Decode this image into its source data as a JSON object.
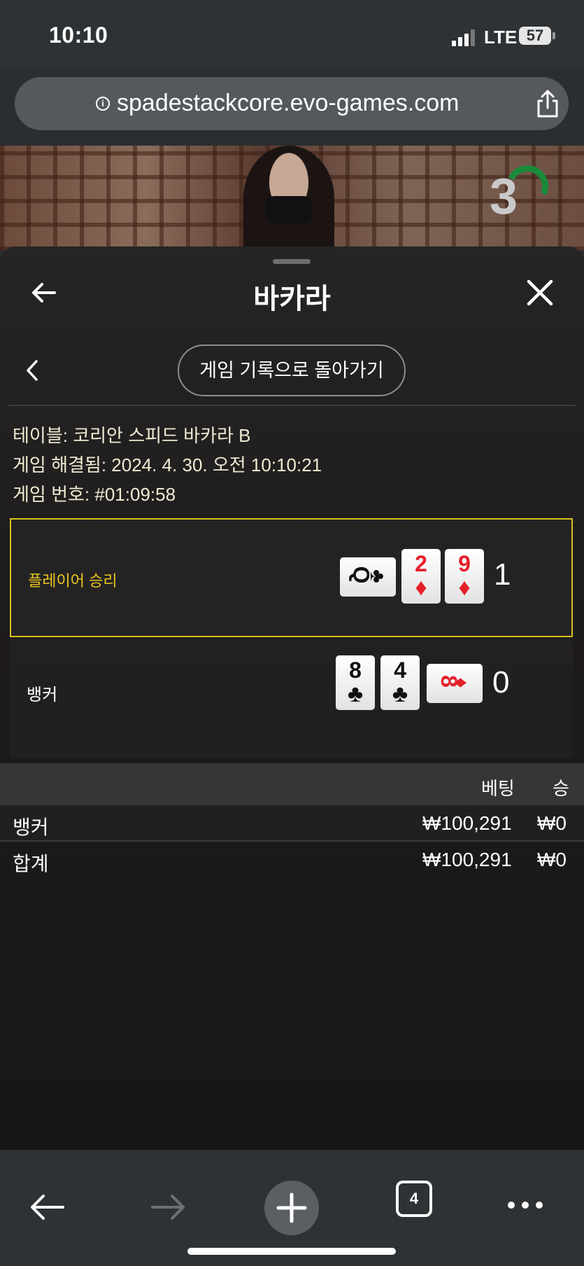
{
  "status_bar": {
    "time": "10:10",
    "network": "LTE",
    "battery": "57"
  },
  "browser": {
    "url": "spadestackcore.evo-games.com",
    "tab_count": "4"
  },
  "video": {
    "countdown": "3"
  },
  "sheet": {
    "title": "바카라",
    "history_button": "게임 기록으로 돌아가기"
  },
  "details": {
    "table_label": "테이블:",
    "table_value": "코리안 스피드 바카라 B",
    "resolved_label": "게임 해결됨:",
    "resolved_value": "2024. 4. 30. 오전 10:10:21",
    "game_no_label": "게임 번호:",
    "game_no_value": "#01:09:58"
  },
  "results": {
    "player": {
      "label": "플레이어 승리",
      "score": "1",
      "cards": [
        {
          "rank": "Q",
          "suit": "♣",
          "color": "black",
          "orientation": "sideways"
        },
        {
          "rank": "2",
          "suit": "♦",
          "color": "red",
          "orientation": "upright"
        },
        {
          "rank": "9",
          "suit": "♦",
          "color": "red",
          "orientation": "upright"
        }
      ]
    },
    "banker": {
      "label": "뱅커",
      "score": "0",
      "cards": [
        {
          "rank": "8",
          "suit": "♣",
          "color": "black",
          "orientation": "upright"
        },
        {
          "rank": "4",
          "suit": "♣",
          "color": "black",
          "orientation": "upright"
        },
        {
          "rank": "8",
          "suit": "♦",
          "color": "red",
          "orientation": "sideways"
        }
      ]
    }
  },
  "bets_table": {
    "headers": {
      "bet": "베팅",
      "win": "승"
    },
    "rows": [
      {
        "name": "뱅커",
        "bet": "₩100,291",
        "win": "₩0"
      },
      {
        "name": "합계",
        "bet": "₩100,291",
        "win": "₩0"
      }
    ]
  },
  "colors": {
    "highlight": "#d8c21e",
    "red_suit": "#e4202a",
    "timer": "#1a8a3a"
  }
}
